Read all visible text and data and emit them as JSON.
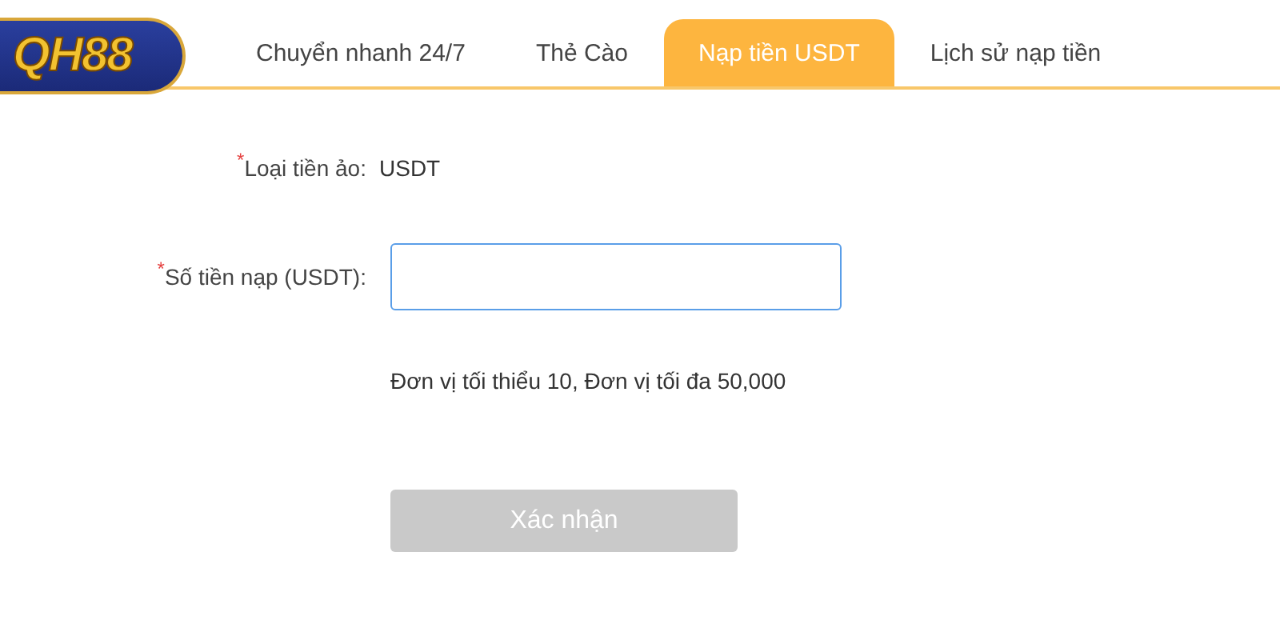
{
  "logo": {
    "text": "QH88"
  },
  "tabs": [
    {
      "label": "Chuyển nhanh 24/7",
      "selected": false
    },
    {
      "label": "Thẻ Cào",
      "selected": false
    },
    {
      "label": "Nạp tiền USDT",
      "selected": true
    },
    {
      "label": "Lịch sử nạp tiền",
      "selected": false
    }
  ],
  "form": {
    "fields": [
      {
        "kind": "text",
        "mark": "*",
        "label": "Loại tiền ảo:",
        "value": "USDT"
      },
      {
        "kind": "input",
        "mark": "*",
        "label": "Số tiền nạp (USDT):"
      }
    ],
    "hint": "Đơn vị tối thiểu 10, Đơn vị tối đa 50,000",
    "submit": {
      "label": "Xác nhận",
      "disabled": true
    }
  }
}
